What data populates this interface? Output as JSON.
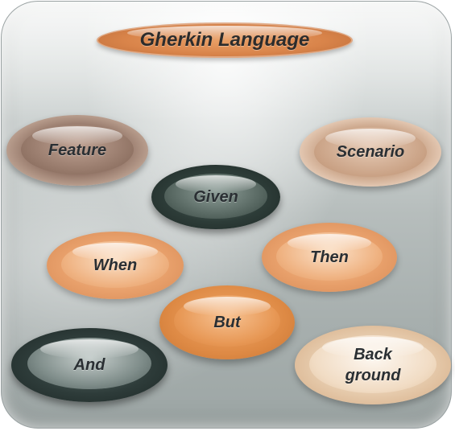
{
  "title": "Gherkin Language",
  "keywords": {
    "feature": "Feature",
    "scenario": "Scenario",
    "given": "Given",
    "when": "When",
    "then": "Then",
    "but": "But",
    "and": "And",
    "background": "Back\nground"
  },
  "colors": {
    "title_pill": "#d9844a",
    "feature_pill": "#8f7163",
    "scenario_pill": "#c59d80",
    "given_pill": "#2d3c38",
    "when_pill": "#e8a06b",
    "then_pill": "#e8a06b",
    "but_pill": "#de8a45",
    "and_pill": "#2e3c3a",
    "background_pill": "#e5c9aa",
    "panel": "#b6bdbc",
    "text": "#2a2f33"
  }
}
